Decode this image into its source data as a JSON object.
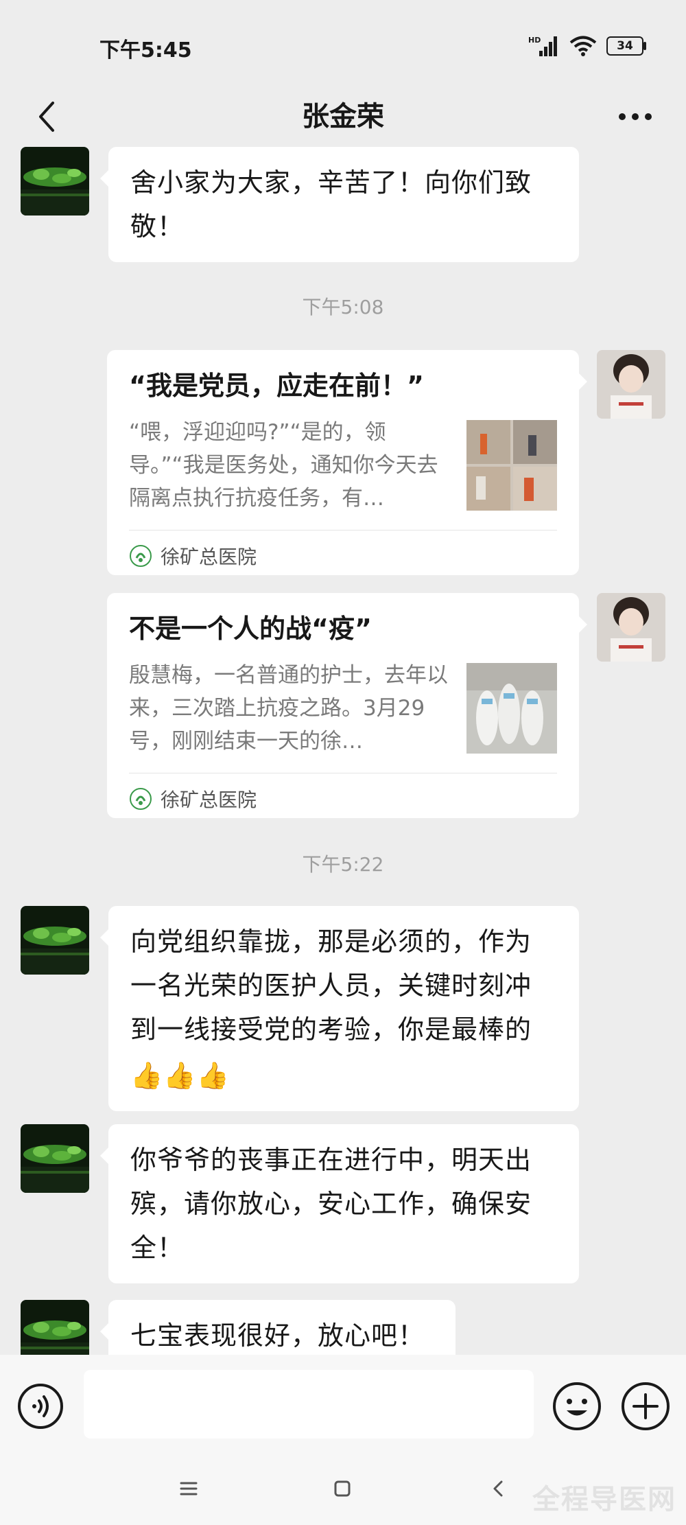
{
  "status_bar": {
    "time": "下午5:45",
    "network": "HD",
    "battery": "34"
  },
  "nav": {
    "title": "张金荣"
  },
  "messages": [
    {
      "text": "舍小家为大家，辛苦了！向你们致敬！"
    },
    {
      "timestamp": "下午5:08"
    },
    {
      "card_title": "“我是党员，应走在前！”",
      "card_desc": "“喂，浮迎迎吗?”“是的，领导。”“我是医务处，通知你今天去隔离点执行抗疫任务，有…",
      "card_source": "徐矿总医院"
    },
    {
      "card_title": "不是一个人的战“疫”",
      "card_desc": "殷慧梅，一名普通的护士，去年以来，三次踏上抗疫之路。3月29号，刚刚结束一天的徐…",
      "card_source": "徐矿总医院"
    },
    {
      "timestamp": "下午5:22"
    },
    {
      "text": "向党组织靠拢，那是必须的，作为一名光荣的医护人员，关键时刻冲到一线接受党的考验，你是最棒的",
      "emoji": "👍👍👍"
    },
    {
      "text": "你爷爷的丧事正在进行中，明天出殡，请你放心，安心工作，确保安全！"
    },
    {
      "text": "七宝表现很好，放心吧！"
    }
  ],
  "input": {
    "placeholder": ""
  },
  "watermark": "全程导医网",
  "colors": {
    "background": "#ededed",
    "bubble": "#ffffff",
    "timestamp": "#9e9e9e",
    "card_desc": "#7a7a7a"
  }
}
